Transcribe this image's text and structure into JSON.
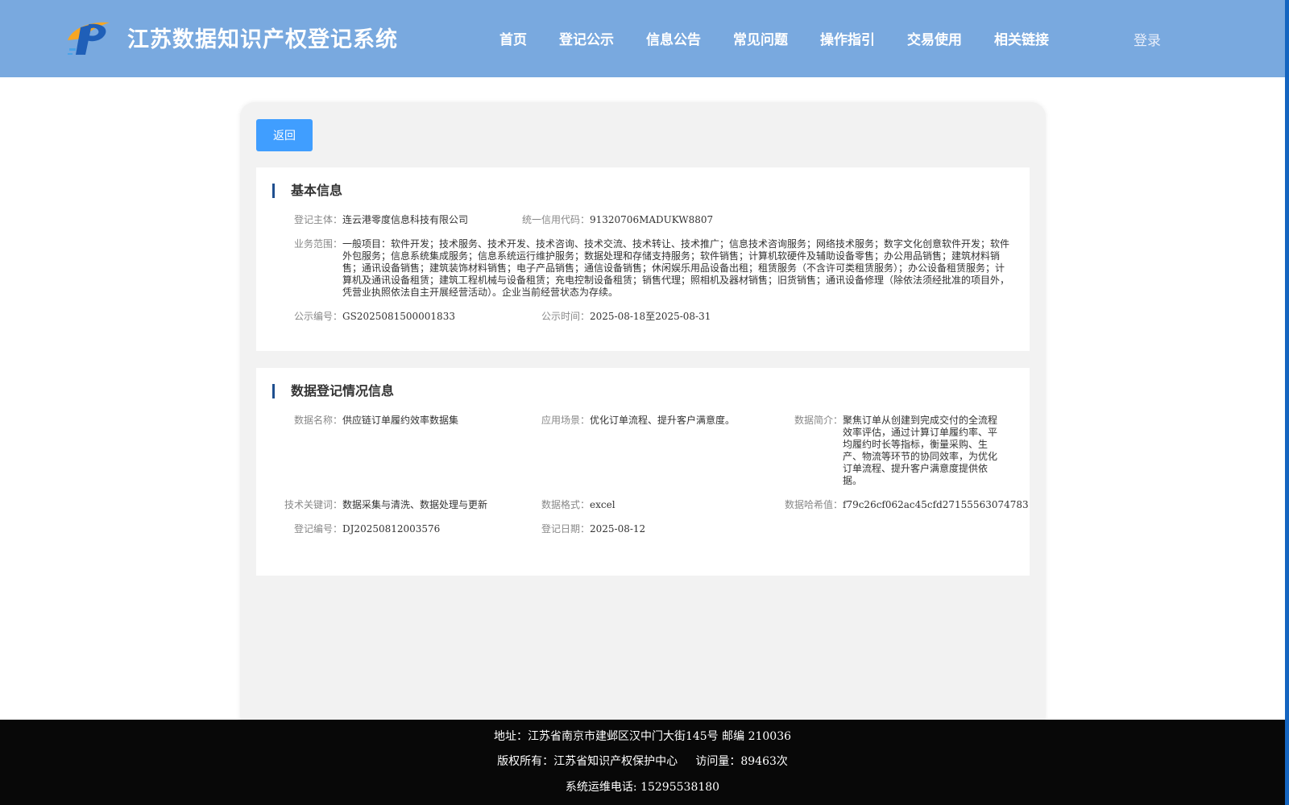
{
  "header": {
    "title": "江苏数据知识产权登记系统",
    "nav": [
      "首页",
      "登记公示",
      "信息公告",
      "常见问题",
      "操作指引",
      "交易使用",
      "相关链接"
    ],
    "login": "登录"
  },
  "back_label": "返回",
  "basic": {
    "title": "基本信息",
    "entity_label": "登记主体：",
    "entity_value": "连云港零度信息科技有限公司",
    "credit_label": "统一信用代码：",
    "credit_value": "91320706MADUKW8807",
    "scope_label": "业务范围：",
    "scope_value": "一般项目：软件开发；技术服务、技术开发、技术咨询、技术交流、技术转让、技术推广；信息技术咨询服务；网络技术服务；数字文化创意软件开发；软件外包服务；信息系统集成服务；信息系统运行维护服务；数据处理和存储支持服务；软件销售；计算机软硬件及辅助设备零售；办公用品销售；建筑材料销售；通讯设备销售；建筑装饰材料销售；电子产品销售；通信设备销售；休闲娱乐用品设备出租；租赁服务（不含许可类租赁服务）；办公设备租赁服务；计算机及通讯设备租赁；建筑工程机械与设备租赁；充电控制设备租赁；销售代理；照相机及器材销售；旧货销售；通讯设备修理（除依法须经批准的项目外，凭营业执照依法自主开展经营活动）。企业当前经营状态为存续。",
    "pub_no_label": "公示编号：",
    "pub_no_value": "GS2025081500001833",
    "pub_time_label": "公示时间：",
    "pub_time_value": "2025-08-18至2025-08-31"
  },
  "data_info": {
    "title": "数据登记情况信息",
    "name_label": "数据名称：",
    "name_value": "供应链订单履约效率数据集",
    "scene_label": "应用场景：",
    "scene_value": "优化订单流程、提升客户满意度。",
    "intro_label": "数据简介：",
    "intro_value": "聚焦订单从创建到完成交付的全流程效率评估，通过计算订单履约率、平均履约时长等指标，衡量采购、生产、物流等环节的协同效率，为优化订单流程、提升客户满意度提供依据。",
    "keyword_label": "技术关键词：",
    "keyword_value": "数据采集与清洗、数据处理与更新",
    "format_label": "数据格式：",
    "format_value": "excel",
    "hash_label": "数据哈希值：",
    "hash_value": "f79c26cf062ac45cfd27155563074783",
    "reg_no_label": "登记编号：",
    "reg_no_value": "DJ20250812003576",
    "reg_date_label": "登记日期：",
    "reg_date_value": "2025-08-12"
  },
  "footer": {
    "address": "地址：江苏省南京市建邺区汉中门大街145号 邮编 210036",
    "copyright": "版权所有：江苏省知识产权保护中心     访问量：89463次",
    "phone": "系统运维电话: 15295538180"
  },
  "colors": {
    "header": "#79a9df",
    "button": "#409eff",
    "footer": "#080808",
    "accent_bar": "#1f4f8f"
  }
}
